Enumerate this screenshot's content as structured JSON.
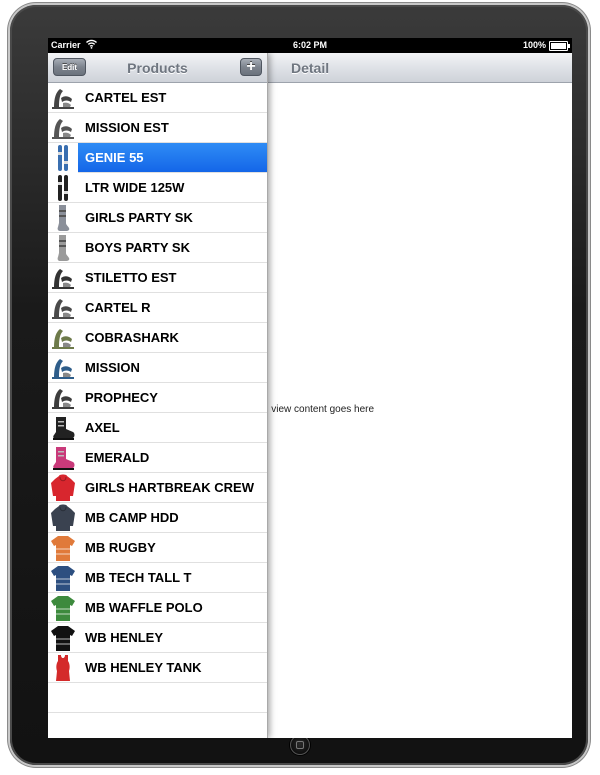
{
  "status_bar": {
    "carrier": "Carrier",
    "time": "6:02 PM",
    "battery": "100%"
  },
  "master": {
    "title": "Products",
    "edit_label": "Edit",
    "add_label": "+"
  },
  "detail": {
    "title": "Detail",
    "content": "il view content goes here"
  },
  "products": [
    {
      "name": "CARTEL EST",
      "icon": "binding",
      "color": "#444444"
    },
    {
      "name": "MISSION EST",
      "icon": "binding",
      "color": "#555555"
    },
    {
      "name": "GENIE 55",
      "icon": "ski",
      "color": "#3a6fb0",
      "selected": true
    },
    {
      "name": "LTR WIDE 125W",
      "icon": "ski",
      "color": "#222222"
    },
    {
      "name": "GIRLS PARTY SK",
      "icon": "sock",
      "color": "#8a8f99"
    },
    {
      "name": "BOYS PARTY SK",
      "icon": "sock",
      "color": "#9a9a9a"
    },
    {
      "name": "STILETTO EST",
      "icon": "binding",
      "color": "#333333"
    },
    {
      "name": "CARTEL  R",
      "icon": "binding",
      "color": "#4a4a4a"
    },
    {
      "name": "COBRASHARK",
      "icon": "binding",
      "color": "#6d7a4a"
    },
    {
      "name": "MISSION",
      "icon": "binding",
      "color": "#2e5d8a"
    },
    {
      "name": "PROPHECY",
      "icon": "binding",
      "color": "#3d3d3d"
    },
    {
      "name": "AXEL",
      "icon": "boot",
      "color": "#222222"
    },
    {
      "name": "EMERALD",
      "icon": "boot",
      "color": "#c93a7a"
    },
    {
      "name": "GIRLS HARTBREAK CREW",
      "icon": "hoodie",
      "color": "#d8262e"
    },
    {
      "name": "MB CAMP HDD",
      "icon": "hoodie",
      "color": "#3a4250"
    },
    {
      "name": "MB RUGBY",
      "icon": "shirt",
      "color": "#e07a3a"
    },
    {
      "name": "MB TECH TALL T",
      "icon": "shirt",
      "color": "#2d4f80"
    },
    {
      "name": "MB WAFFLE POLO",
      "icon": "shirt",
      "color": "#3d8a3d"
    },
    {
      "name": "WB HENLEY",
      "icon": "shirt",
      "color": "#111111"
    },
    {
      "name": "WB HENLEY TANK",
      "icon": "tank",
      "color": "#d42a2a"
    }
  ]
}
